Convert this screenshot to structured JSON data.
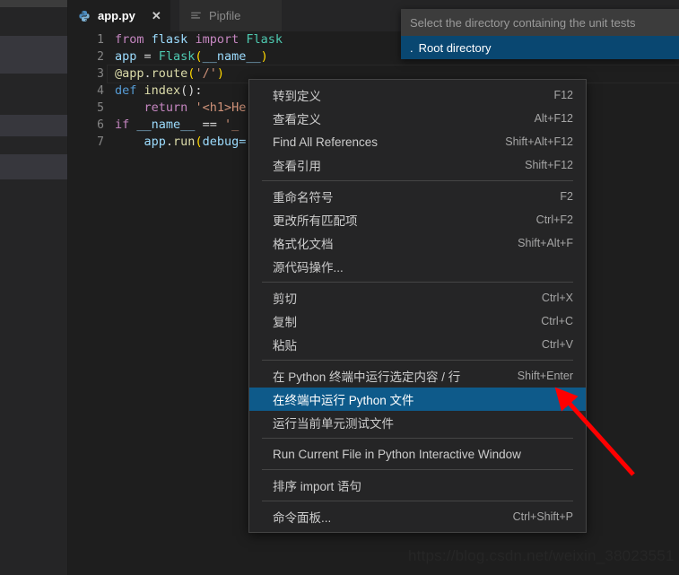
{
  "window": {
    "background": "#1e1e1e",
    "accent_blue": "#0e5a8a",
    "quickpick_select": "#094771"
  },
  "tabs": [
    {
      "label": "app.py",
      "icon": "python-file-icon",
      "active": true,
      "close": "✕"
    },
    {
      "label": "Pipfile",
      "icon": "list-file-icon",
      "active": false
    }
  ],
  "editor": {
    "lines": [
      {
        "num": "1",
        "tokens": [
          {
            "t": "from",
            "c": "kw"
          },
          {
            "t": " ",
            "c": "pl"
          },
          {
            "t": "flask",
            "c": "id"
          },
          {
            "t": " ",
            "c": "pl"
          },
          {
            "t": "import",
            "c": "kw"
          },
          {
            "t": " ",
            "c": "pl"
          },
          {
            "t": "Flask",
            "c": "ty"
          }
        ]
      },
      {
        "num": "2",
        "tokens": [
          {
            "t": "app",
            "c": "id"
          },
          {
            "t": " = ",
            "c": "pl"
          },
          {
            "t": "Flask",
            "c": "ty"
          },
          {
            "t": "(",
            "c": "br1"
          },
          {
            "t": "__name__",
            "c": "id"
          },
          {
            "t": ")",
            "c": "br1"
          }
        ]
      },
      {
        "num": "3",
        "tokens": [
          {
            "t": "@app",
            "c": "fn"
          },
          {
            "t": ".",
            "c": "pl"
          },
          {
            "t": "route",
            "c": "fn"
          },
          {
            "t": "(",
            "c": "br1"
          },
          {
            "t": "'/'",
            "c": "str"
          },
          {
            "t": ")",
            "c": "br1"
          }
        ]
      },
      {
        "num": "4",
        "tokens": [
          {
            "t": "def",
            "c": "def"
          },
          {
            "t": " ",
            "c": "pl"
          },
          {
            "t": "index",
            "c": "fn"
          },
          {
            "t": "():",
            "c": "pl"
          }
        ]
      },
      {
        "num": "5",
        "tokens": [
          {
            "t": "    ",
            "c": "pl"
          },
          {
            "t": "return",
            "c": "kw"
          },
          {
            "t": " ",
            "c": "pl"
          },
          {
            "t": "'<h1>He",
            "c": "str"
          }
        ]
      },
      {
        "num": "6",
        "tokens": [
          {
            "t": "if",
            "c": "kw"
          },
          {
            "t": " ",
            "c": "pl"
          },
          {
            "t": "__name__",
            "c": "id"
          },
          {
            "t": " == ",
            "c": "pl"
          },
          {
            "t": "'_",
            "c": "str"
          }
        ]
      },
      {
        "num": "7",
        "tokens": [
          {
            "t": "    ",
            "c": "pl"
          },
          {
            "t": "app",
            "c": "id"
          },
          {
            "t": ".",
            "c": "pl"
          },
          {
            "t": "run",
            "c": "fn"
          },
          {
            "t": "(",
            "c": "br1"
          },
          {
            "t": "debug=",
            "c": "id"
          }
        ]
      }
    ]
  },
  "quickpick": {
    "placeholder": "Select the directory containing the unit tests",
    "selected_item": "Root directory",
    "selected_prefix": "."
  },
  "context_menu": {
    "groups": [
      [
        {
          "label": "转到定义",
          "key": "F12",
          "selected": false
        },
        {
          "label": "查看定义",
          "key": "Alt+F12",
          "selected": false
        },
        {
          "label": "Find All References",
          "key": "Shift+Alt+F12",
          "selected": false
        },
        {
          "label": "查看引用",
          "key": "Shift+F12",
          "selected": false
        }
      ],
      [
        {
          "label": "重命名符号",
          "key": "F2",
          "selected": false
        },
        {
          "label": "更改所有匹配项",
          "key": "Ctrl+F2",
          "selected": false
        },
        {
          "label": "格式化文档",
          "key": "Shift+Alt+F",
          "selected": false
        },
        {
          "label": "源代码操作...",
          "key": "",
          "selected": false
        }
      ],
      [
        {
          "label": "剪切",
          "key": "Ctrl+X",
          "selected": false
        },
        {
          "label": "复制",
          "key": "Ctrl+C",
          "selected": false
        },
        {
          "label": "粘贴",
          "key": "Ctrl+V",
          "selected": false
        }
      ],
      [
        {
          "label": "在 Python 终端中运行选定内容 / 行",
          "key": "Shift+Enter",
          "selected": false
        },
        {
          "label": "在终端中运行 Python 文件",
          "key": "",
          "selected": true
        },
        {
          "label": "运行当前单元测试文件",
          "key": "",
          "selected": false
        }
      ],
      [
        {
          "label": "Run Current File in Python Interactive Window",
          "key": "",
          "selected": false
        }
      ],
      [
        {
          "label": "排序 import 语句",
          "key": "",
          "selected": false
        }
      ],
      [
        {
          "label": "命令面板...",
          "key": "Ctrl+Shift+P",
          "selected": false
        }
      ]
    ]
  },
  "annotation": {
    "arrow_color": "#ff0000",
    "arrow_from": "705,528",
    "arrow_to": "620,434"
  },
  "watermark": {
    "text": "https://blog.csdn.net/weixin_38023551"
  }
}
